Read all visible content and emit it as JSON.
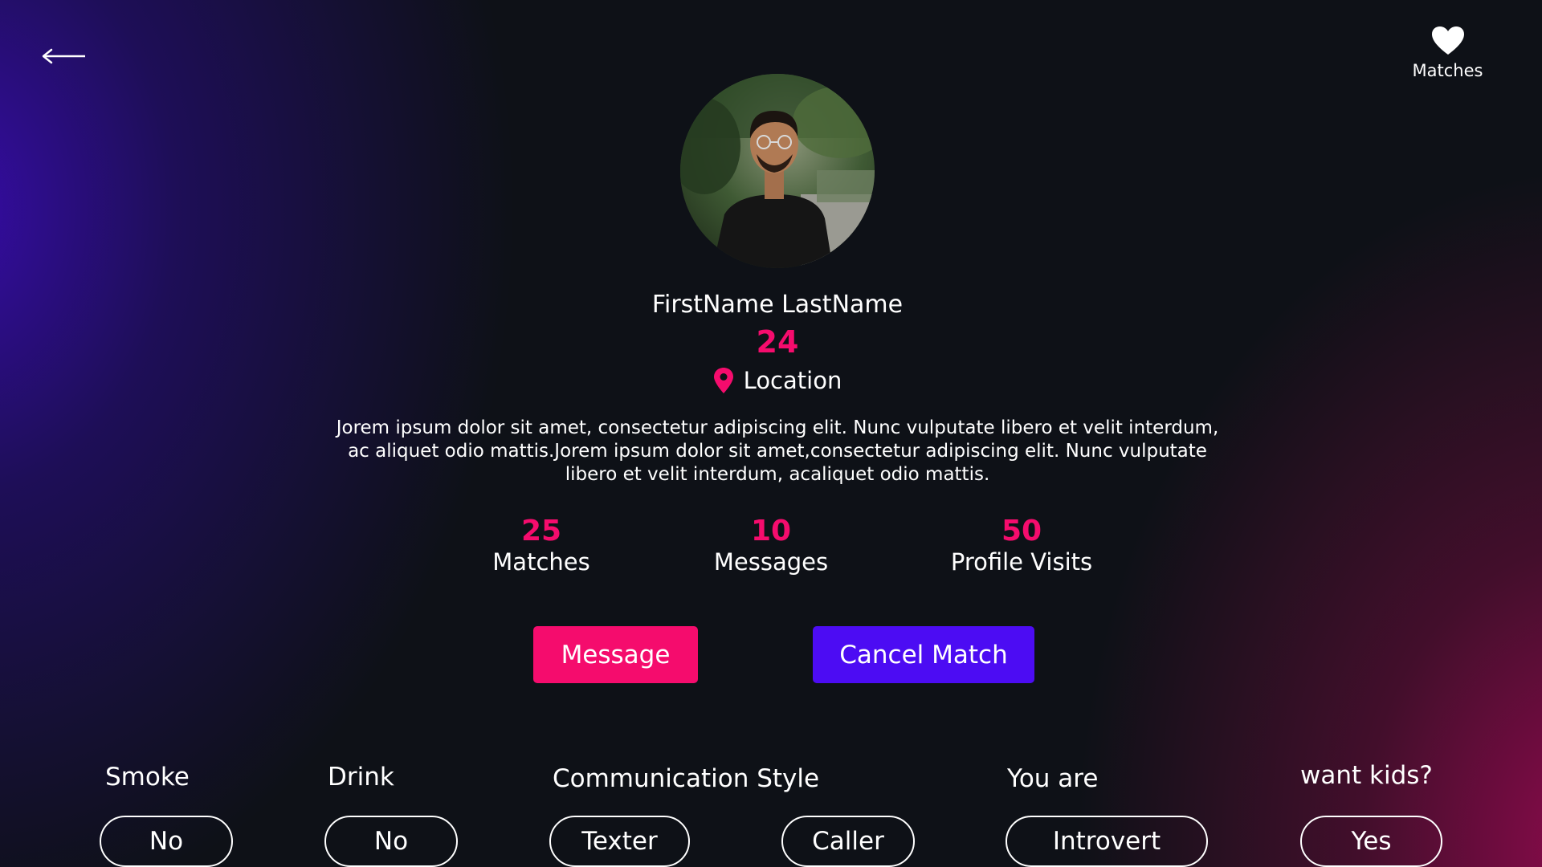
{
  "nav": {
    "back_icon": "left-arrow-icon",
    "matches_icon": "heart-icon",
    "matches_label": "Matches"
  },
  "profile": {
    "name": "FirstName LastName",
    "age": "24",
    "location_icon": "map-pin-icon",
    "location": "Location",
    "bio": "Jorem ipsum dolor sit amet, consectetur adipiscing elit. Nunc vulputate libero et velit interdum, ac aliquet odio mattis.Jorem ipsum dolor sit amet,consectetur adipiscing elit. Nunc vulputate libero et velit interdum, acaliquet odio mattis."
  },
  "stats": [
    {
      "value": "25",
      "label": "Matches"
    },
    {
      "value": "10",
      "label": "Messages"
    },
    {
      "value": "50",
      "label": "Profile Visits"
    }
  ],
  "actions": {
    "message_label": "Message",
    "cancel_label": "Cancel Match"
  },
  "preferences": {
    "smoke": {
      "label": "Smoke",
      "value": "No"
    },
    "drink": {
      "label": "Drink",
      "value": "No"
    },
    "communication": {
      "label": "Communication Style",
      "options": [
        "Texter",
        "Caller"
      ]
    },
    "personality": {
      "label": "You are",
      "value": "Introvert"
    },
    "kids": {
      "label": "want kids?",
      "value": "Yes"
    }
  },
  "colors": {
    "accent_pink": "#f50c6d",
    "accent_purple": "#4c0cf3",
    "background": "#0e1117"
  }
}
